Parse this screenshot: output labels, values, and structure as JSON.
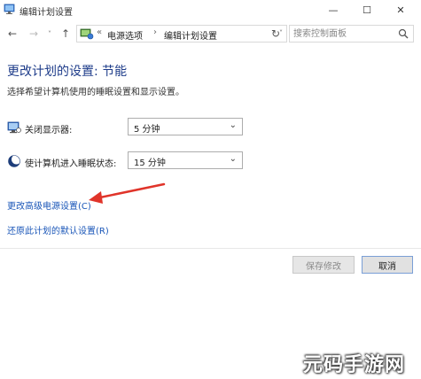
{
  "window": {
    "title": "编辑计划设置",
    "minimize": "—",
    "maximize": "☐",
    "close": "✕"
  },
  "nav": {
    "back": "←",
    "forward": "→",
    "recent": "˅",
    "up": "↑",
    "breadcrumb_sep_root": "«",
    "breadcrumbs": [
      "电源选项",
      "编辑计划设置"
    ],
    "breadcrumb_sep": "›",
    "address_dropdown": "˅",
    "refresh": "↻",
    "search_placeholder": "搜索控制面板"
  },
  "content": {
    "heading": "更改计划的设置: 节能",
    "subtitle": "选择希望计算机使用的睡眠设置和显示设置。",
    "settings": [
      {
        "label": "关闭显示器:",
        "value": "5 分钟",
        "icon": "monitor-icon"
      },
      {
        "label": "使计算机进入睡眠状态:",
        "value": "15 分钟",
        "icon": "moon-icon"
      }
    ],
    "links": {
      "advanced": "更改高级电源设置(C)",
      "restore": "还原此计划的默认设置(R)"
    }
  },
  "buttons": {
    "save": "保存修改",
    "cancel": "取消"
  },
  "watermark": {
    "text": "元码手游网"
  },
  "colors": {
    "heading": "#1e3c8a",
    "link": "#1a56b8",
    "annotation_arrow": "#e0342a"
  }
}
